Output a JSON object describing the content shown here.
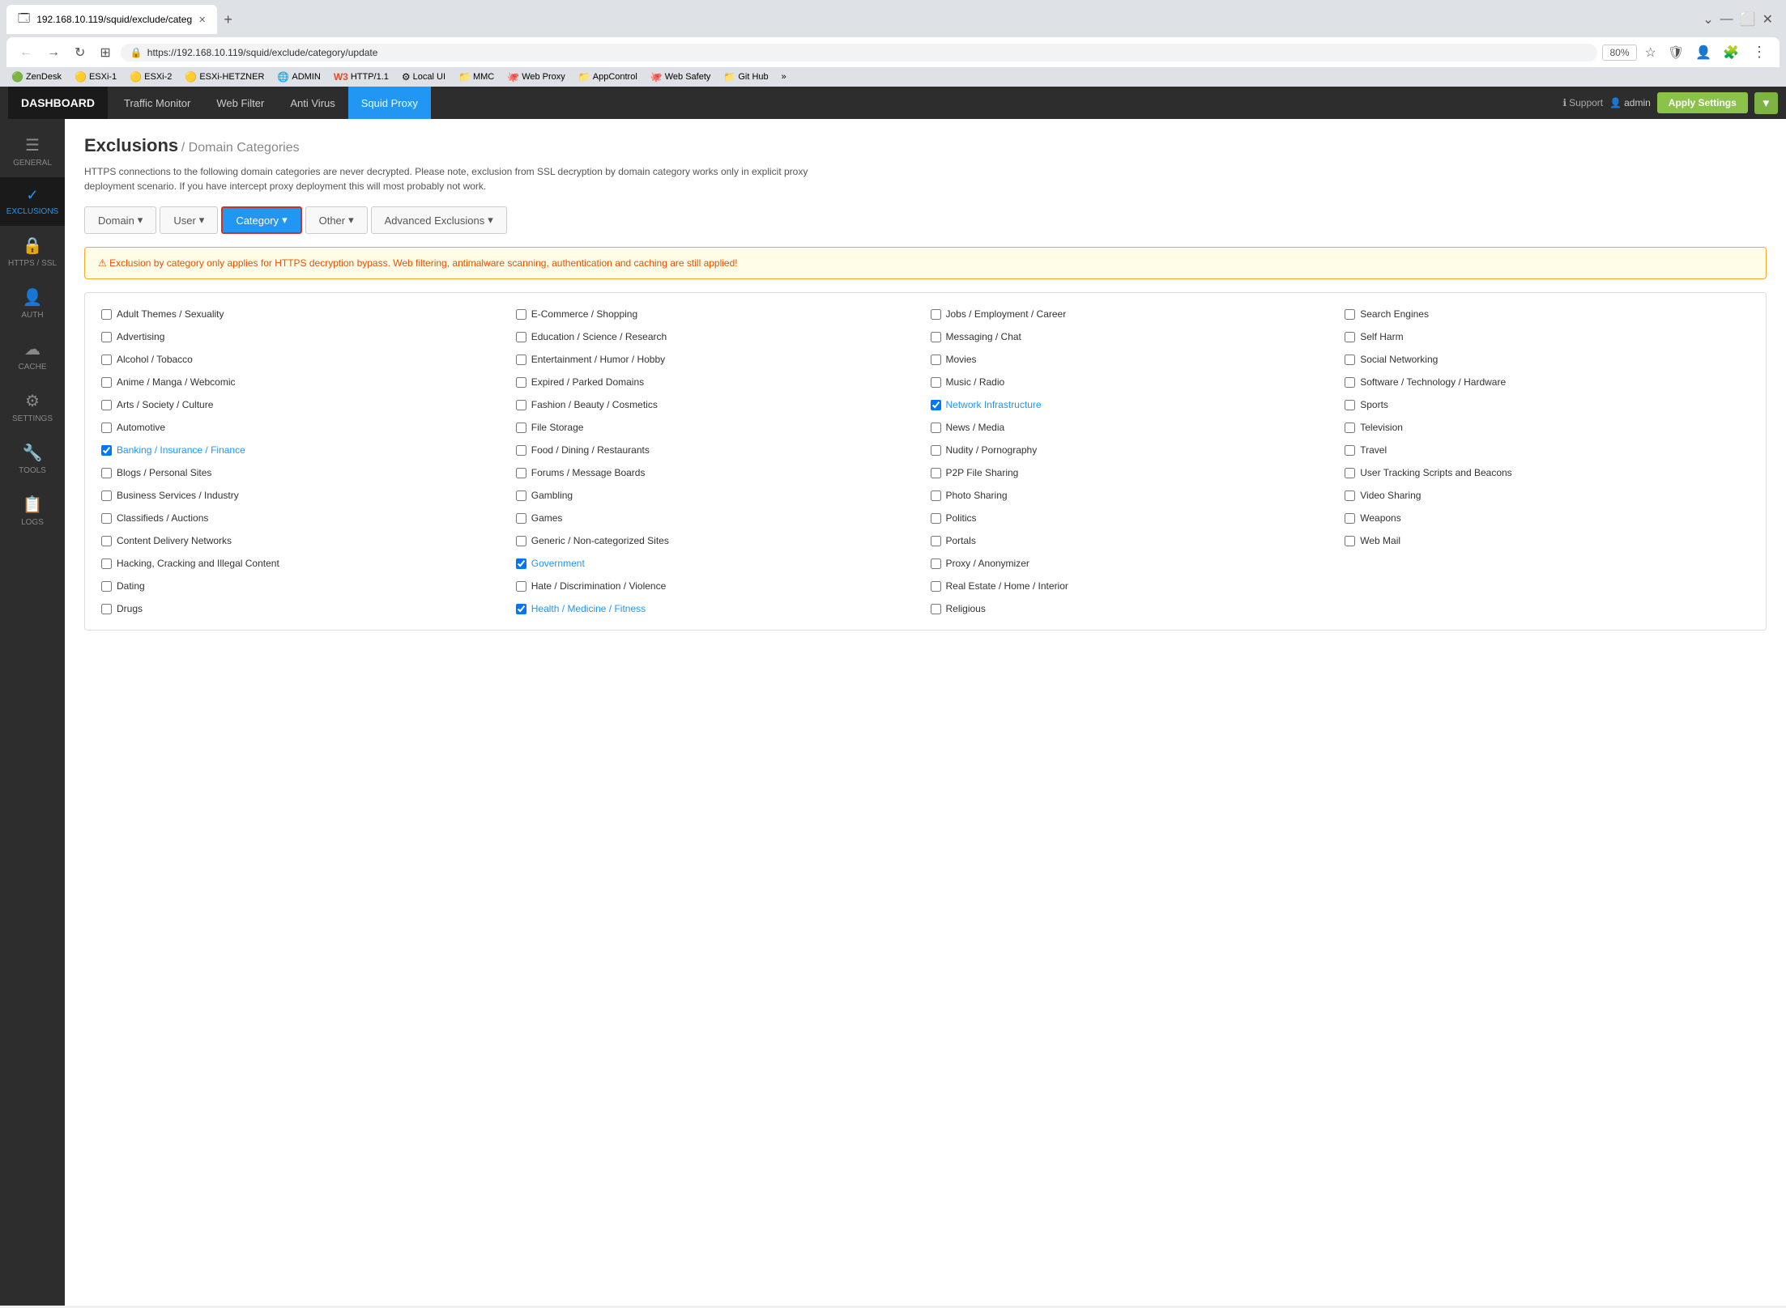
{
  "browser": {
    "tab_url": "192.168.10.119/squid/exclude/categ",
    "tab_icon": "🗔",
    "new_tab_label": "+",
    "address": "https://192.168.10.119/squid/exclude/category/update",
    "zoom": "80%",
    "expand_icon": "⌄",
    "minimize": "—",
    "restore": "⬜",
    "close": "✕"
  },
  "bookmarks": [
    {
      "icon": "🟢",
      "label": "ZenDesk"
    },
    {
      "icon": "🟡",
      "label": "ESXi-1"
    },
    {
      "icon": "🟡",
      "label": "ESXi-2"
    },
    {
      "icon": "🟡",
      "label": "ESXi-HETZNER"
    },
    {
      "icon": "🌐",
      "label": "ADMIN"
    },
    {
      "icon": "W3",
      "label": "HTTP/1.1"
    },
    {
      "icon": "⚙",
      "label": "Local UI"
    },
    {
      "icon": "📁",
      "label": "MMC"
    },
    {
      "icon": "🐙",
      "label": "Web Proxy"
    },
    {
      "icon": "📁",
      "label": "AppControl"
    },
    {
      "icon": "🐙",
      "label": "Web Safety"
    },
    {
      "icon": "📁",
      "label": "Git Hub"
    },
    {
      "icon": "»",
      "label": ""
    }
  ],
  "topnav": {
    "brand": "DASHBOARD",
    "items": [
      {
        "label": "Traffic Monitor",
        "active": false
      },
      {
        "label": "Web Filter",
        "active": false
      },
      {
        "label": "Anti Virus",
        "active": false
      },
      {
        "label": "Squid Proxy",
        "active": true
      }
    ],
    "support_label": "Support",
    "admin_label": "admin",
    "apply_label": "Apply Settings"
  },
  "sidebar": {
    "items": [
      {
        "icon": "☰",
        "label": "GENERAL",
        "active": false
      },
      {
        "icon": "✓",
        "label": "EXCLUSIONS",
        "active": true
      },
      {
        "icon": "🔒",
        "label": "HTTPS / SSL",
        "active": false
      },
      {
        "icon": "👤",
        "label": "AUTH",
        "active": false
      },
      {
        "icon": "☁",
        "label": "CACHE",
        "active": false
      },
      {
        "icon": "⚙",
        "label": "SETTINGS",
        "active": false
      },
      {
        "icon": "🔧",
        "label": "TOOLS",
        "active": false
      },
      {
        "icon": "📋",
        "label": "LOGS",
        "active": false
      }
    ]
  },
  "page": {
    "title": "Exclusions",
    "breadcrumb": "/ Domain Categories",
    "description": "HTTPS connections to the following domain categories are never decrypted. Please note, exclusion from SSL decryption by domain category works only in explicit proxy deployment scenario. If you have intercept proxy deployment this will most probably not work."
  },
  "tabs": [
    {
      "label": "Domain",
      "dropdown": true,
      "active": false
    },
    {
      "label": "User",
      "dropdown": true,
      "active": false
    },
    {
      "label": "Category",
      "dropdown": true,
      "active": true
    },
    {
      "label": "Other",
      "dropdown": true,
      "active": false
    },
    {
      "label": "Advanced Exclusions",
      "dropdown": true,
      "active": false
    }
  ],
  "warning": "Exclusion by category only applies for HTTPS decryption bypass. Web filtering, antimalware scanning, authentication and caching are still applied!",
  "categories": [
    [
      {
        "label": "Adult Themes / Sexuality",
        "checked": false
      },
      {
        "label": "Advertising",
        "checked": false
      },
      {
        "label": "Alcohol / Tobacco",
        "checked": false
      },
      {
        "label": "Anime / Manga / Webcomic",
        "checked": false
      },
      {
        "label": "Arts / Society / Culture",
        "checked": false
      },
      {
        "label": "Automotive",
        "checked": false
      },
      {
        "label": "Banking / Insurance / Finance",
        "checked": true
      },
      {
        "label": "Blogs / Personal Sites",
        "checked": false
      },
      {
        "label": "Business Services / Industry",
        "checked": false
      },
      {
        "label": "Classifieds / Auctions",
        "checked": false
      },
      {
        "label": "Content Delivery Networks",
        "checked": false
      },
      {
        "label": "Hacking, Cracking and Illegal Content",
        "checked": false
      },
      {
        "label": "Dating",
        "checked": false
      },
      {
        "label": "Drugs",
        "checked": false
      }
    ],
    [
      {
        "label": "E-Commerce / Shopping",
        "checked": false
      },
      {
        "label": "Education / Science / Research",
        "checked": false
      },
      {
        "label": "Entertainment / Humor / Hobby",
        "checked": false
      },
      {
        "label": "Expired / Parked Domains",
        "checked": false
      },
      {
        "label": "Fashion / Beauty / Cosmetics",
        "checked": false
      },
      {
        "label": "File Storage",
        "checked": false
      },
      {
        "label": "Food / Dining / Restaurants",
        "checked": false
      },
      {
        "label": "Forums / Message Boards",
        "checked": false
      },
      {
        "label": "Gambling",
        "checked": false
      },
      {
        "label": "Games",
        "checked": false
      },
      {
        "label": "Generic / Non-categorized Sites",
        "checked": false
      },
      {
        "label": "Government",
        "checked": true
      },
      {
        "label": "Hate / Discrimination / Violence",
        "checked": false
      },
      {
        "label": "Health / Medicine / Fitness",
        "checked": true
      }
    ],
    [
      {
        "label": "Jobs / Employment / Career",
        "checked": false
      },
      {
        "label": "Messaging / Chat",
        "checked": false
      },
      {
        "label": "Movies",
        "checked": false
      },
      {
        "label": "Music / Radio",
        "checked": false
      },
      {
        "label": "Network Infrastructure",
        "checked": true
      },
      {
        "label": "News / Media",
        "checked": false
      },
      {
        "label": "Nudity / Pornography",
        "checked": false
      },
      {
        "label": "P2P File Sharing",
        "checked": false
      },
      {
        "label": "Photo Sharing",
        "checked": false
      },
      {
        "label": "Politics",
        "checked": false
      },
      {
        "label": "Portals",
        "checked": false
      },
      {
        "label": "Proxy / Anonymizer",
        "checked": false
      },
      {
        "label": "Real Estate / Home / Interior",
        "checked": false
      },
      {
        "label": "Religious",
        "checked": false
      }
    ],
    [
      {
        "label": "Search Engines",
        "checked": false
      },
      {
        "label": "Self Harm",
        "checked": false
      },
      {
        "label": "Social Networking",
        "checked": false
      },
      {
        "label": "Software / Technology / Hardware",
        "checked": false
      },
      {
        "label": "Sports",
        "checked": false
      },
      {
        "label": "Television",
        "checked": false
      },
      {
        "label": "Travel",
        "checked": false
      },
      {
        "label": "User Tracking Scripts and Beacons",
        "checked": false
      },
      {
        "label": "Video Sharing",
        "checked": false
      },
      {
        "label": "Weapons",
        "checked": false
      },
      {
        "label": "Web Mail",
        "checked": false
      }
    ]
  ]
}
